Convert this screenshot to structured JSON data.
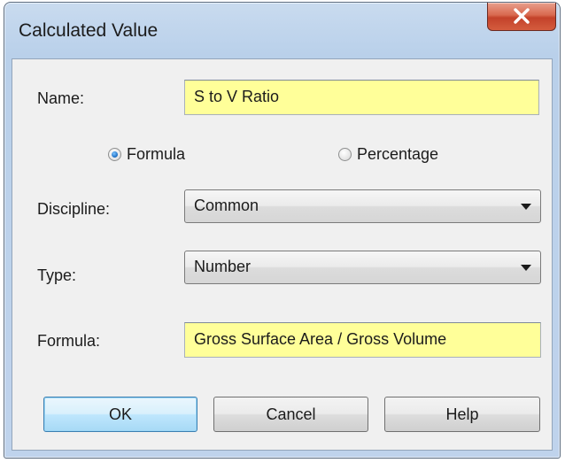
{
  "window": {
    "title": "Calculated Value"
  },
  "fields": {
    "name_label": "Name:",
    "name_value": "S to V Ratio",
    "discipline_label": "Discipline:",
    "discipline_value": "Common",
    "type_label": "Type:",
    "type_value": "Number",
    "formula_label": "Formula:",
    "formula_value": "Gross Surface Area / Gross Volume"
  },
  "mode": {
    "formula_label": "Formula",
    "percentage_label": "Percentage",
    "selected": "Formula"
  },
  "buttons": {
    "ok": "OK",
    "cancel": "Cancel",
    "help": "Help"
  },
  "colors": {
    "input_highlight": "#ffff99",
    "close_button": "#c3422a"
  }
}
